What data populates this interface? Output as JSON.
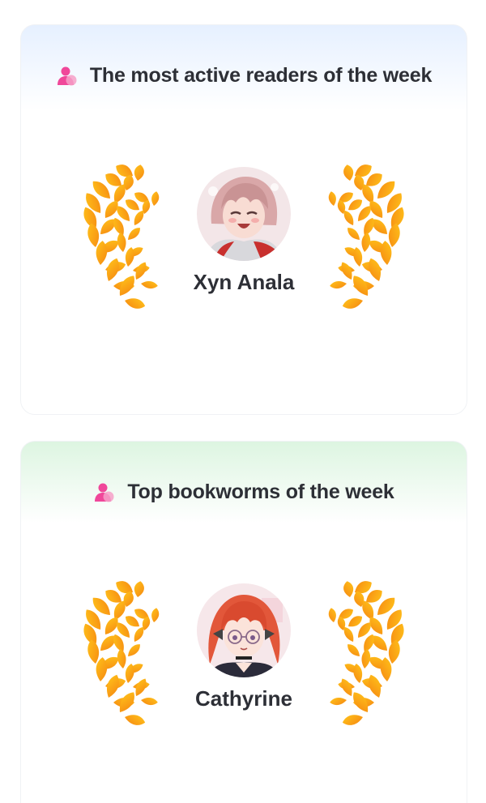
{
  "sections": [
    {
      "title": "The most active readers of the week",
      "header_icon": "user-icon",
      "winner_name": "Xyn Anala",
      "avatar": "anime-avatar-pink-hair",
      "header_gradient": "#e6f0ff"
    },
    {
      "title": "Top bookworms of the week",
      "header_icon": "user-icon",
      "winner_name": "Cathyrine",
      "avatar": "anime-avatar-red-hair",
      "header_gradient": "#ddf5e1"
    }
  ],
  "colors": {
    "title_text": "#2d2f36",
    "icon_pink": "#f0479a",
    "laurel_gold": "#ffc21a",
    "laurel_orange": "#f68a12"
  }
}
